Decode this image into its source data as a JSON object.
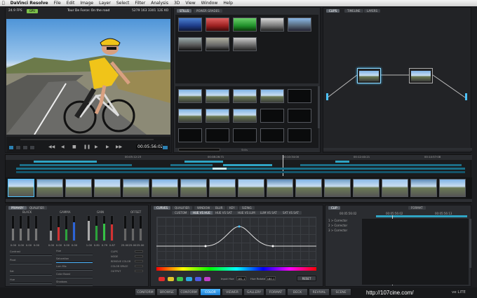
{
  "menubar": {
    "apple": "",
    "app": "DaVinci Resolve",
    "items": [
      "File",
      "Edit",
      "Image",
      "Layer",
      "Select",
      "Filter",
      "Analysis",
      "3D",
      "View",
      "Window",
      "Help"
    ]
  },
  "viewer": {
    "fps": "24.9 FPS",
    "gpu": "GPU",
    "title": "Tour De Force: On the road",
    "clip_info": "5279 163 3301",
    "clip_suffix": "12E KO",
    "timecode": "00:05:56:02"
  },
  "gallery": {
    "tabs": [
      "STILLS",
      "POWER GRADES"
    ],
    "status": "Stills"
  },
  "nodes": {
    "tabs": [
      "CLIPS",
      "TIMELINE",
      "LAYERS"
    ]
  },
  "timeline_ruler": {
    "marks": [
      "00:05:12:23",
      "00:08:26:71",
      "00:10:34:00",
      "00:12:40:21",
      "00:14:57:08"
    ]
  },
  "clip_strip": {
    "count": 16
  },
  "primaries": {
    "tabs": [
      "PRIMARY",
      "QUALIFIER"
    ],
    "groups": [
      "BLACK",
      "GAMMA",
      "GAIN",
      "OFFSET"
    ],
    "black_vals": [
      "0.00",
      "0.00",
      "0.00",
      "0.00"
    ],
    "gamma_vals": [
      "0.00",
      "0.00",
      "0.00",
      "0.00"
    ],
    "gain_vals": [
      "1.00",
      "0.81",
      "0.79",
      "0.87"
    ],
    "offset_vals": [
      "25.00",
      "25.00",
      "25.00",
      "25.00"
    ],
    "left_sliders": [
      "Contrast",
      "Pivot",
      "Sat",
      "Hue"
    ],
    "mid_sliders": [
      "Hue",
      "Saturation",
      "Lum Mix",
      "Color Boost",
      "Shadows"
    ],
    "right_labels": [
      "CLIPS",
      "NODE",
      "REMOVE COLOR",
      "COLOR SPACE",
      "OUTPUT"
    ]
  },
  "curves": {
    "tabs": [
      "CURVES",
      "QUALIFIER",
      "WINDOW",
      "BLUR",
      "KEY",
      "SIZING"
    ],
    "subtabs": [
      "CUSTOM",
      "HUE VS HUE",
      "HUE VS SAT",
      "HUE VS LUM",
      "LUM VS SAT",
      "SAT VS SAT"
    ],
    "input_label": "Input Hue",
    "input_val": "181.1",
    "output_label": "Hue Rotate",
    "output_val": "180.1",
    "reset": "RESET",
    "swatches": [
      "#e02c2c",
      "#e0c42c",
      "#3bc34a",
      "#2ca6e0",
      "#4f5ae0",
      "#c040c8"
    ]
  },
  "keyframes": {
    "tabs": [
      "CLIP",
      "FORMAT"
    ],
    "tc_left": "00:05:56:02",
    "tc_mid": "00:05:56:02",
    "tc_right": "00:05:56:13",
    "rows": [
      "1 > Corrector",
      "2 > Corrector",
      "3 > Corrector"
    ]
  },
  "modules": {
    "items": [
      "CONFORM",
      "BROWSE",
      "CONFORM",
      "COLOR",
      "VIEWER",
      "GALLERY",
      "FORMAT",
      "DECK",
      "REVIVAL",
      "SCENE"
    ],
    "active": "COLOR",
    "brand": "ve LITE"
  },
  "watermark": "http://107cine.com/"
}
